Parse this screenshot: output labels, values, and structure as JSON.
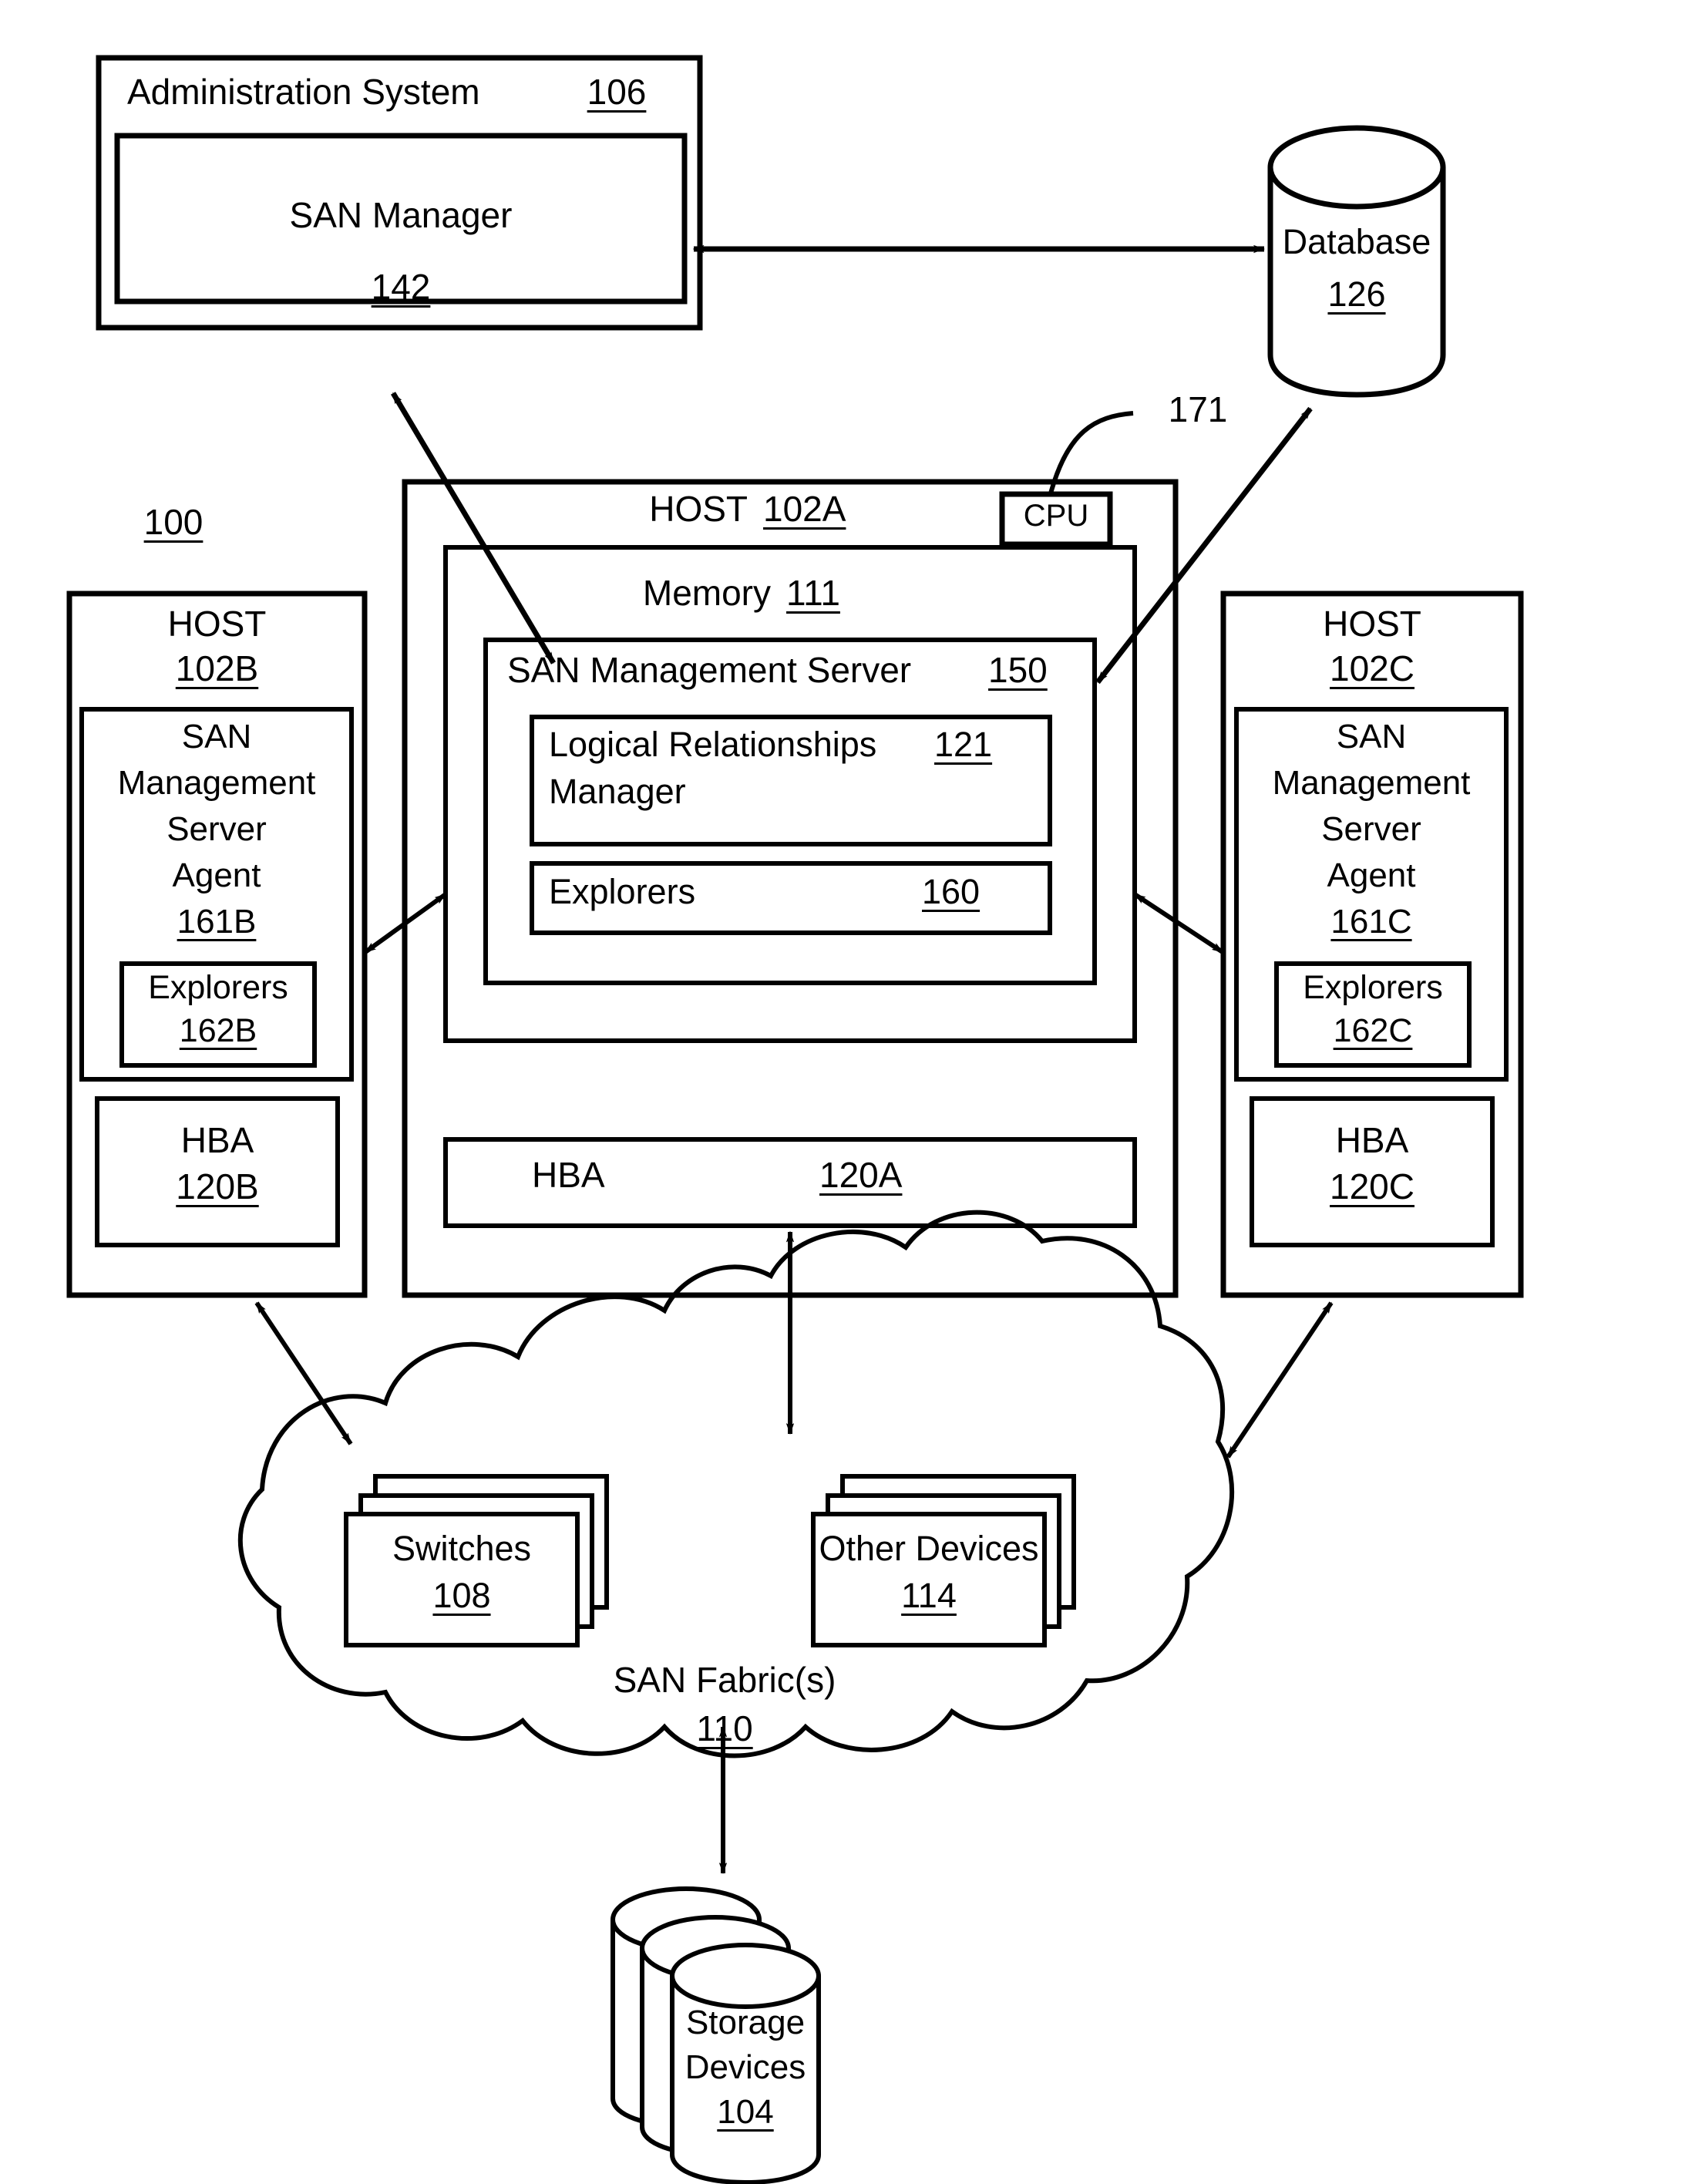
{
  "figure": {
    "system_ref": "100",
    "callout_171": "171"
  },
  "admin_system": {
    "title": "Administration System",
    "ref": "106",
    "san_manager": {
      "title": "SAN Manager",
      "ref": "142"
    }
  },
  "database": {
    "title": "Database",
    "ref": "126"
  },
  "host_a": {
    "title": "HOST",
    "ref": "102A",
    "cpu_label": "CPU",
    "memory": {
      "title": "Memory",
      "ref": "111"
    },
    "san_management_server": {
      "title": "SAN Management Server",
      "ref": "150",
      "logical_relationships_manager": {
        "line1": "Logical Relationships",
        "line2": "Manager",
        "ref": "121"
      },
      "explorers": {
        "title": "Explorers",
        "ref": "160"
      }
    },
    "hba": {
      "title": "HBA",
      "ref": "120A"
    }
  },
  "host_b": {
    "title": "HOST",
    "ref": "102B",
    "agent": {
      "line1": "SAN",
      "line2": "Management",
      "line3": "Server",
      "line4": "Agent",
      "ref": "161B",
      "explorers": {
        "title": "Explorers",
        "ref": "162B"
      }
    },
    "hba": {
      "title": "HBA",
      "ref": "120B"
    }
  },
  "host_c": {
    "title": "HOST",
    "ref": "102C",
    "agent": {
      "line1": "SAN",
      "line2": "Management",
      "line3": "Server",
      "line4": "Agent",
      "ref": "161C",
      "explorers": {
        "title": "Explorers",
        "ref": "162C"
      }
    },
    "hba": {
      "title": "HBA",
      "ref": "120C"
    }
  },
  "san_fabric": {
    "title": "SAN Fabric(s)",
    "ref": "110",
    "switches": {
      "title": "Switches",
      "ref": "108"
    },
    "other_devices": {
      "title": "Other Devices",
      "ref": "114"
    }
  },
  "storage_devices": {
    "line1": "Storage",
    "line2": "Devices",
    "ref": "104"
  }
}
